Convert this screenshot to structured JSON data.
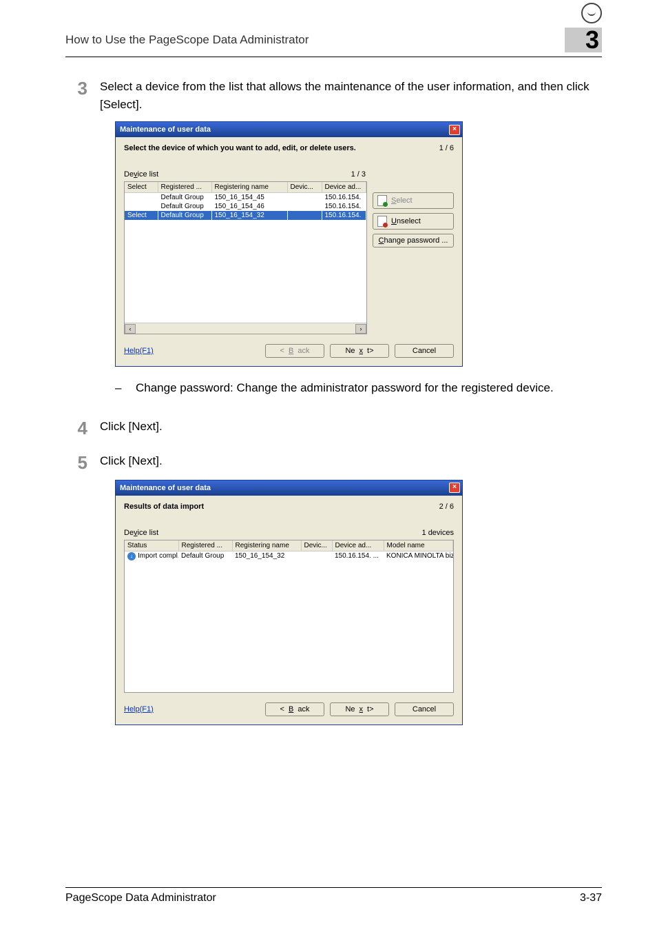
{
  "header": {
    "title": "How to Use the PageScope Data Administrator",
    "chapter": "3"
  },
  "step3": {
    "num": "3",
    "text": "Select a device from the list that allows the maintenance of the user information, and then click [Select]."
  },
  "dialog1": {
    "title": "Maintenance of user data",
    "instruction": "Select the device of which you want to add, edit, or delete users.",
    "step_counter": "1 / 6",
    "device_list_label": "Device list",
    "device_count": "1 / 3",
    "columns": {
      "c1": "Select",
      "c2": "Registered ...",
      "c3": "Registering name",
      "c4": "Devic...",
      "c5": "Device ad..."
    },
    "rows": [
      {
        "select": "",
        "reg": "Default Group",
        "name": "150_16_154_45",
        "dev": "",
        "addr": "150.16.154."
      },
      {
        "select": "",
        "reg": "Default Group",
        "name": "150_16_154_46",
        "dev": "",
        "addr": "150.16.154."
      },
      {
        "select": "Select",
        "reg": "Default Group",
        "name": "150_16_154_32",
        "dev": "",
        "addr": "150.16.154."
      }
    ],
    "buttons": {
      "select": "Select",
      "unselect": "Unselect",
      "change_pw": "Change password ..."
    },
    "help": "Help(F1)",
    "back": "< Back",
    "next": "Next>",
    "cancel": "Cancel"
  },
  "sub_bullet": {
    "dash": "–",
    "text": "Change password: Change the administrator password for the registered device."
  },
  "step4": {
    "num": "4",
    "text": "Click [Next]."
  },
  "step5": {
    "num": "5",
    "text": "Click [Next]."
  },
  "dialog2": {
    "title": "Maintenance of user data",
    "instruction": "Results of data import",
    "step_counter": "2 / 6",
    "device_list_label": "Device list",
    "device_count": "1 devices",
    "columns": {
      "c1": "Status",
      "c2": "Registered ...",
      "c3": "Registering name",
      "c4": "Devic...",
      "c5": "Device ad...",
      "c6": "Model name"
    },
    "row": {
      "status": "Import compl...",
      "reg": "Default Group",
      "name": "150_16_154_32",
      "dev": "",
      "addr": "150.16.154. ...",
      "model": "KONICA MINOLTA bizh..."
    },
    "help": "Help(F1)",
    "back": "< Back",
    "next": "Next>",
    "cancel": "Cancel"
  },
  "footer": {
    "product": "PageScope Data Administrator",
    "page": "3-37"
  }
}
